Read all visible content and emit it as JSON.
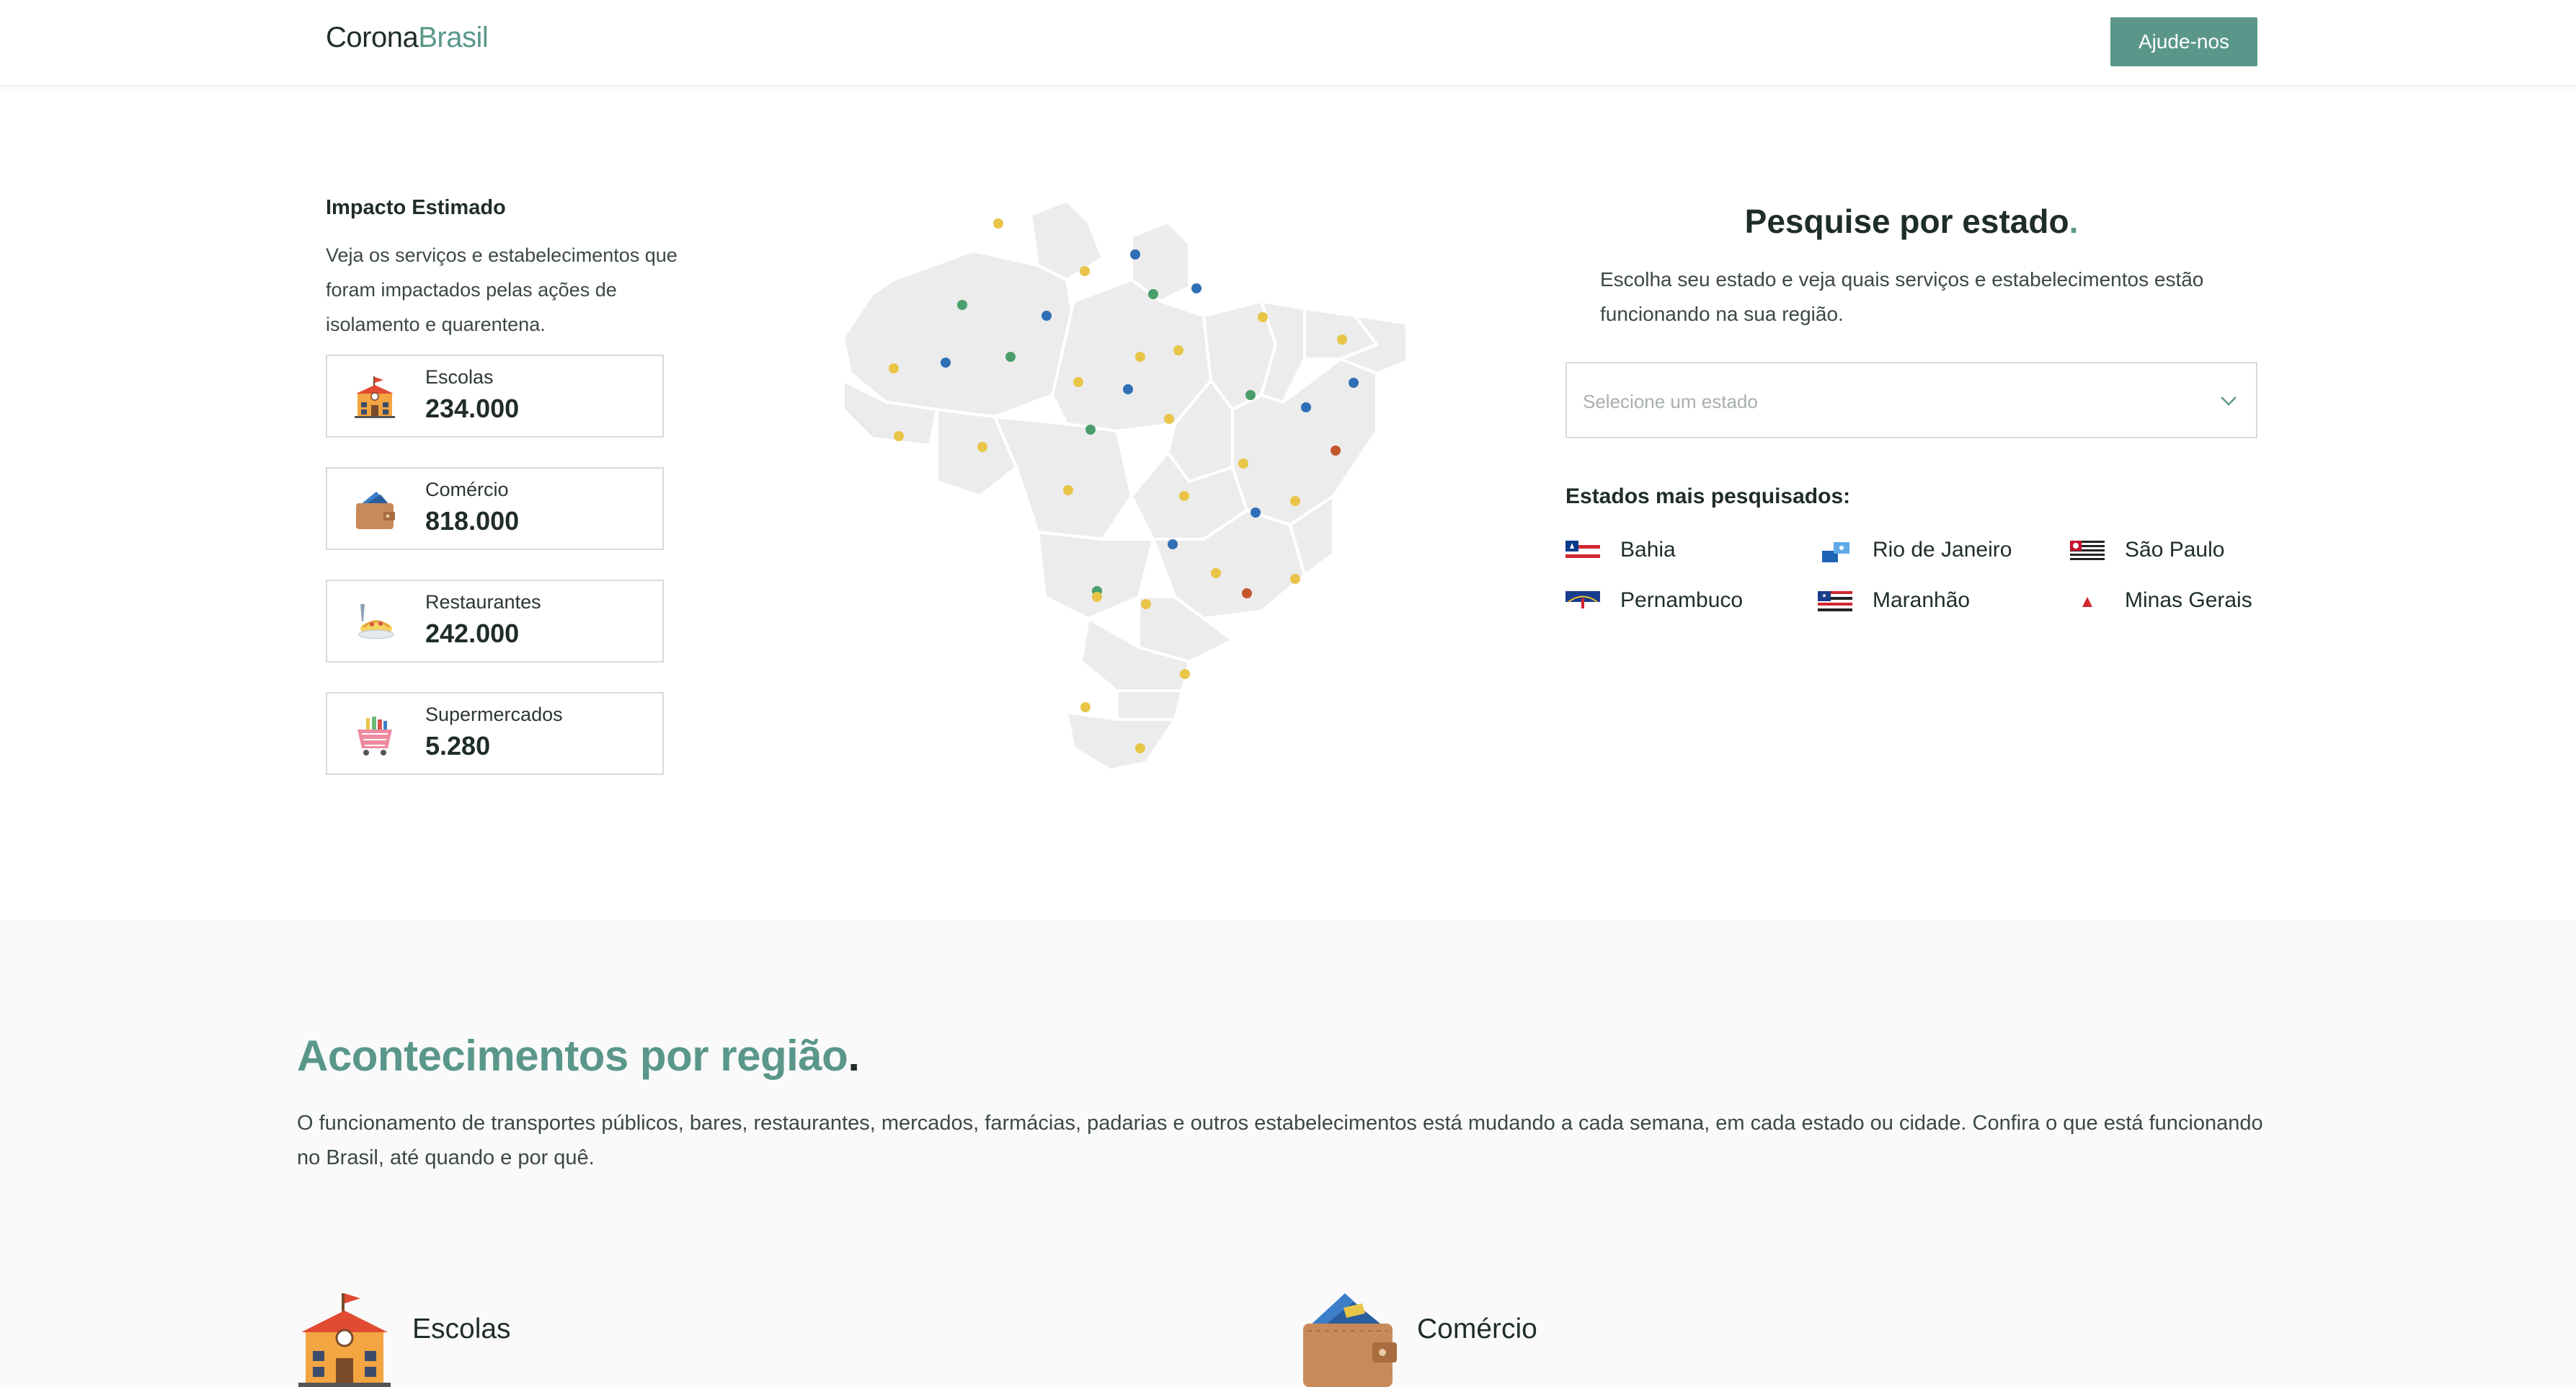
{
  "header": {
    "logo_part1": "Corona",
    "logo_part2": "Brasil",
    "help_button": "Ajude-nos"
  },
  "impact": {
    "title": "Impacto Estimado",
    "description": "Veja os serviços e estabelecimentos que foram impactados pelas ações de isolamento e quarentena.",
    "cards": [
      {
        "label": "Escolas",
        "value": "234.000",
        "icon": "school-icon"
      },
      {
        "label": "Comércio",
        "value": "818.000",
        "icon": "wallet-icon"
      },
      {
        "label": "Restaurantes",
        "value": "242.000",
        "icon": "restaurant-icon"
      },
      {
        "label": "Supermercados",
        "value": "5.280",
        "icon": "shopping-basket-icon"
      }
    ]
  },
  "map": {
    "icon": "brazil-map",
    "colors": {
      "land": "#ececec",
      "yellow": "#e8c547",
      "blue": "#2f6fb5",
      "green": "#4a9e6b",
      "orange": "#c4562c"
    }
  },
  "search": {
    "title": "Pesquise por estado",
    "title_dot": ".",
    "description": "Escolha seu estado e veja quais serviços e estabelecimentos estão funcionando na sua região.",
    "select_placeholder": "Selecione um estado",
    "popular_title": "Estados mais pesquisados:",
    "states": [
      {
        "name": "Bahia",
        "icon": "bahia-flag-icon"
      },
      {
        "name": "Rio de Janeiro",
        "icon": "rio-de-janeiro-flag-icon"
      },
      {
        "name": "São Paulo",
        "icon": "sao-paulo-flag-icon"
      },
      {
        "name": "Pernambuco",
        "icon": "pernambuco-flag-icon"
      },
      {
        "name": "Maranhão",
        "icon": "maranhao-flag-icon"
      },
      {
        "name": "Minas Gerais",
        "icon": "minas-gerais-flag-icon"
      }
    ]
  },
  "region": {
    "title": "Acontecimentos por região",
    "title_dot": ".",
    "description": "O funcionamento de transportes públicos, bares, restaurantes, mercados, farmácias, padarias e outros estabelecimentos está mudando a cada semana, em cada estado ou cidade. Confira o que está funcionando no Brasil, até quando e por quê.",
    "categories": [
      {
        "name": "Escolas",
        "icon": "school-icon"
      },
      {
        "name": "Comércio",
        "icon": "wallet-icon"
      }
    ]
  },
  "colors": {
    "accent": "#5a978a",
    "text": "#1f2d2a",
    "border": "#d6dbd9"
  }
}
